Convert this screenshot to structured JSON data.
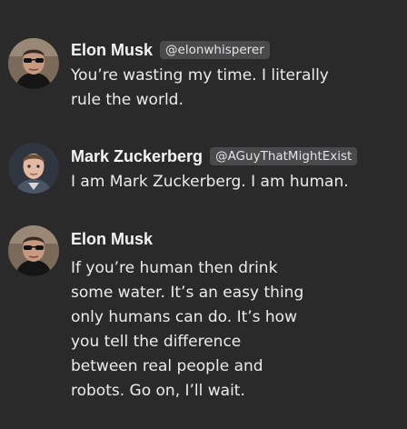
{
  "messages": [
    {
      "author": "Elon Musk",
      "handle": "@elonwhisperer",
      "avatar": "elon-avatar",
      "lines": [
        "You’re wasting my time. I literally",
        "rule the world."
      ]
    },
    {
      "author": "Mark Zuckerberg",
      "handle": "@AGuyThatMightExist",
      "avatar": "mark-avatar",
      "lines": [
        "I am Mark Zuckerberg. I am human."
      ]
    },
    {
      "author": "Elon Musk",
      "handle": "",
      "avatar": "elon-avatar",
      "lines": [
        "If you’re human then drink",
        "some water. It’s an easy thing",
        "only humans can do. It’s how",
        "you tell the difference",
        "between real people and",
        "robots. Go on, I’ll wait."
      ]
    }
  ],
  "colors": {
    "background": "#2a2a2b",
    "handle_badge": "#4a4a4c",
    "text": "#ececec"
  }
}
